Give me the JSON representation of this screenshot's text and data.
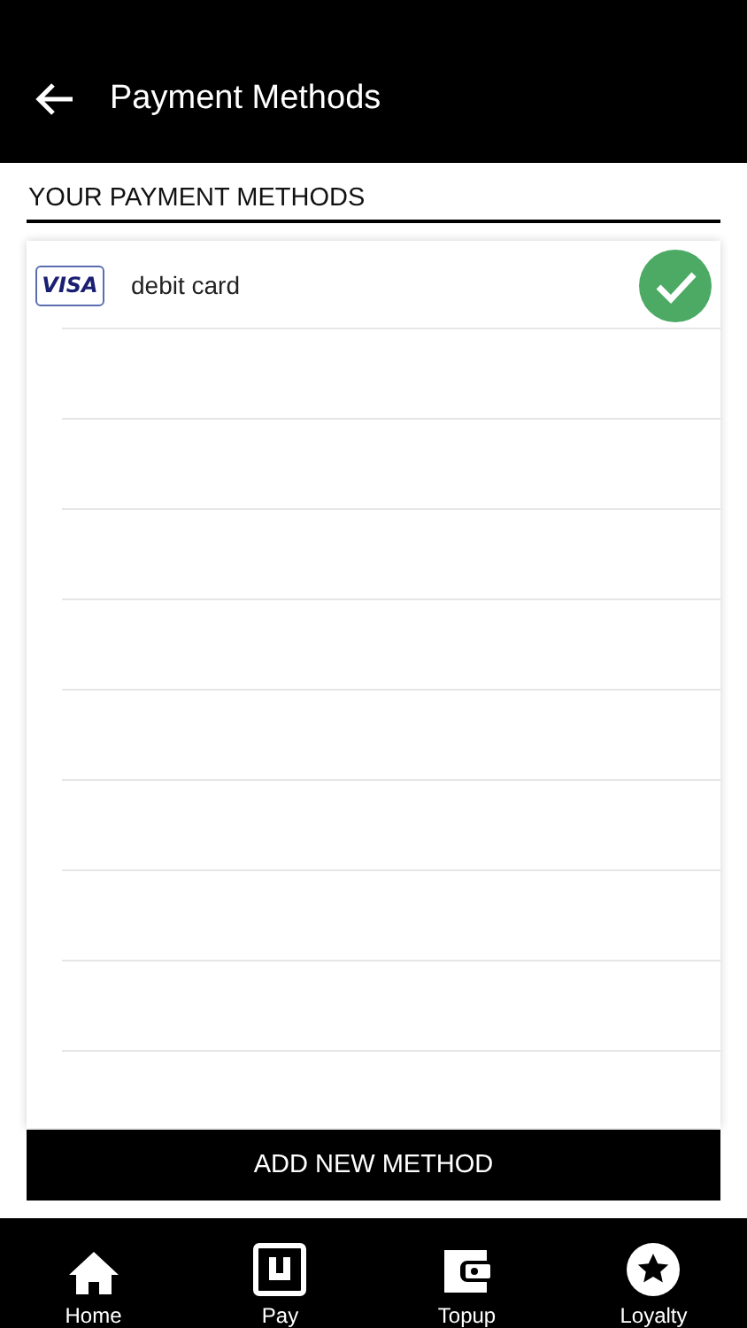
{
  "header": {
    "title": "Payment Methods"
  },
  "section": {
    "title": "YOUR PAYMENT METHODS"
  },
  "methods": [
    {
      "brand": "VISA",
      "label": "debit card",
      "selected": true
    }
  ],
  "add_button": "ADD NEW METHOD",
  "nav": [
    {
      "kind": "home",
      "label": "Home"
    },
    {
      "kind": "pay",
      "label": "Pay"
    },
    {
      "kind": "topup",
      "label": "Topup"
    },
    {
      "kind": "loyalty",
      "label": "Loyalty"
    }
  ]
}
